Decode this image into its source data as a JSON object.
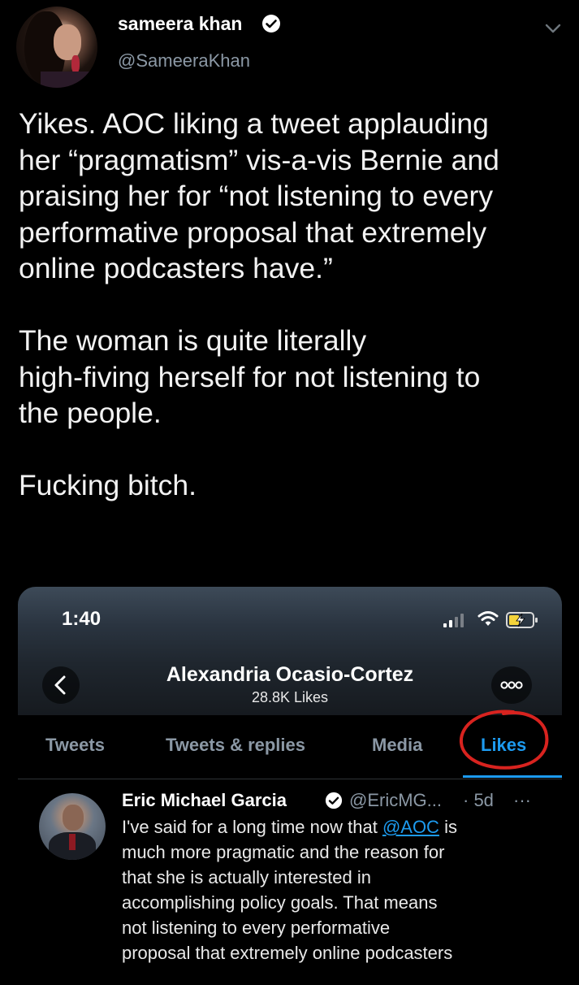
{
  "tweet": {
    "display_name": "sameera khan",
    "handle": "@SameeraKhan",
    "paragraphs": [
      [
        "Yikes. AOC liking a tweet applauding",
        "her “pragmatism” vis-a-vis Bernie and",
        "praising her for “not listening to every",
        "performative proposal that extremely",
        "online podcasters have.”"
      ],
      [
        "The woman is quite literally",
        "high-fiving herself for not listening to",
        "the people."
      ],
      [
        "Fucking bitch."
      ]
    ]
  },
  "embed": {
    "status_time": "1:40",
    "profile_name": "Alexandria Ocasio-Cortez",
    "likes_count": "28.8K Likes",
    "tabs": [
      "Tweets",
      "Tweets & replies",
      "Media",
      "Likes"
    ],
    "active_tab": "Likes",
    "liked_tweet": {
      "name": "Eric Michael Garcia",
      "handle": "@EricMG...",
      "time": "· 5d",
      "more": "···",
      "line1_before": "I've said for a long time now that ",
      "line1_mention": "@AOC",
      "line1_after": " is",
      "lines": [
        "much more pragmatic and the reason for",
        "that she is actually interested in",
        "accomplishing policy goals. That means",
        "not listening to every performative",
        "proposal that extremely online podcasters"
      ]
    }
  },
  "colors": {
    "background": "#000000",
    "link_blue": "#1d9bf0",
    "muted_gray": "#8b98a5",
    "annotation_red": "#d8231f"
  }
}
